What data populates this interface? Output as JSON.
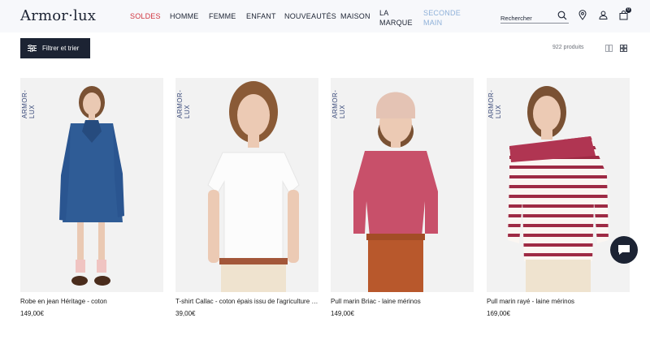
{
  "header": {
    "logo": "Armor·lux",
    "nav": [
      {
        "label": "SOLDES"
      },
      {
        "label": "HOMME"
      },
      {
        "label": "FEMME"
      },
      {
        "label": "ENFANT"
      },
      {
        "label": "NOUVEAUTÉS"
      },
      {
        "label": "MAISON"
      },
      {
        "label_line1": "LA",
        "label_line2": "MARQUE"
      },
      {
        "label_line1": "SECONDE",
        "label_line2": "MAIN"
      }
    ],
    "search_placeholder": "Rechercher",
    "cart_count": "0"
  },
  "toolbar": {
    "filter_label": "Filtrer et trier",
    "product_count": "922 produits"
  },
  "products": [
    {
      "brand": "ARMOR-LUX",
      "name": "Robe en jean Héritage - coton",
      "price": "149,00€"
    },
    {
      "brand": "ARMOR-LUX",
      "name": "T-shirt Callac - coton épais issu de l'agriculture biologique",
      "price": "39,00€"
    },
    {
      "brand": "ARMOR-LUX",
      "name": "Pull marin Briac - laine mérinos",
      "price": "149,00€"
    },
    {
      "brand": "ARMOR-LUX",
      "name": "Pull marin rayé - laine mérinos",
      "price": "169,00€"
    }
  ],
  "colors": {
    "navy": "#1c2333",
    "sale_red": "#d0343f",
    "seconde_main_blue": "#8fb1d9",
    "header_bg": "#f7f8fb"
  },
  "icons": [
    "filter-icon",
    "search-icon",
    "location-pin-icon",
    "account-icon",
    "cart-icon",
    "grid-2-icon",
    "grid-4-icon",
    "chat-icon"
  ]
}
